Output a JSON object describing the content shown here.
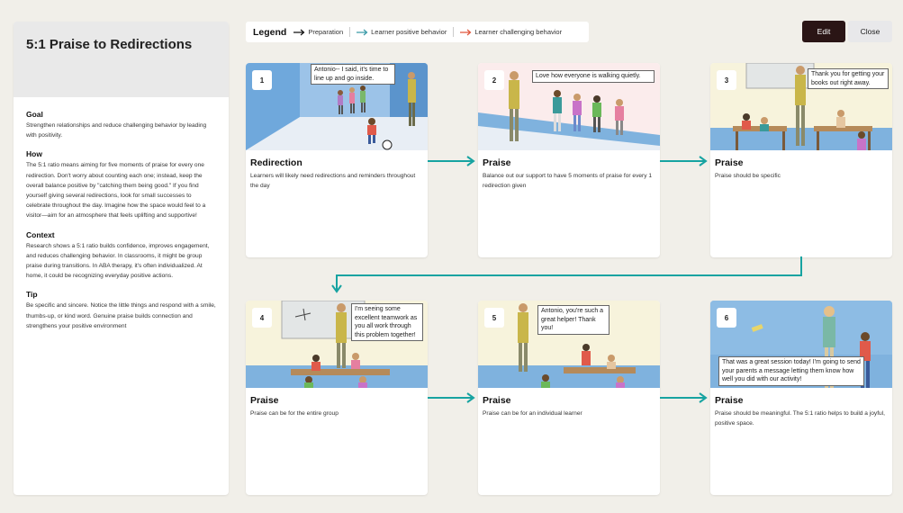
{
  "sidebar": {
    "title": "5:1 Praise to Redirections",
    "sections": [
      {
        "heading": "Goal",
        "text": "Strengthen relationships and reduce challenging behavior by leading with positivity."
      },
      {
        "heading": "How",
        "text": "The 5:1 ratio means aiming for five moments of praise for every one redirection. Don't worry about counting each one; instead, keep the overall balance positive by \"catching them being good.\" If you find yourself giving several redirections, look for small successes to celebrate throughout the day. Imagine how the space would feel to a visitor—aim for an atmosphere that feels uplifting and supportive!"
      },
      {
        "heading": "Context",
        "text": "Research shows a 5:1 ratio builds confidence, improves engagement, and reduces challenging behavior. In classrooms, it might be group praise during transitions. In ABA therapy, it's often individualized. At home, it could be recognizing everyday positive actions."
      },
      {
        "heading": "Tip",
        "text": "Be specific and sincere. Notice the little things and respond with a smile, thumbs-up, or kind word. Genuine praise builds connection and strengthens your positive environment"
      }
    ]
  },
  "legend": {
    "title": "Legend",
    "items": [
      {
        "label": "Preparation",
        "color": "#111111"
      },
      {
        "label": "Learner positive behavior",
        "color": "#3a9aa8"
      },
      {
        "label": "Learner challenging behavior",
        "color": "#e0553a"
      }
    ]
  },
  "buttons": {
    "edit": "Edit",
    "close": "Close"
  },
  "cards": [
    {
      "num": "1",
      "title": "Redirection",
      "desc": "Learners will likely need redirections and reminders throughout the day",
      "bubble": "Antonio-- I said, it's time to line up and go inside."
    },
    {
      "num": "2",
      "title": "Praise",
      "desc": "Balance out our support to have 5 moments of praise for every 1 redirection given",
      "bubble": "Love how everyone is walking quietly."
    },
    {
      "num": "3",
      "title": "Praise",
      "desc": "Praise should be specific",
      "bubble": "Thank you for getting your books out right away."
    },
    {
      "num": "4",
      "title": "Praise",
      "desc": "Praise can be for the entire group",
      "bubble": "I'm seeing some excellent teamwork as you all work through this problem together!"
    },
    {
      "num": "5",
      "title": "Praise",
      "desc": "Praise can be for an individual learner",
      "bubble": "Antonio, you're such a great helper! Thank you!"
    },
    {
      "num": "6",
      "title": "Praise",
      "desc": "Praise should be meaningful. The 5:1 ratio helps to build a joyful, positive space.",
      "bubble": "That was a great session today! I'm going to send your parents a message letting them know how well you did with our activity!"
    }
  ],
  "colors": {
    "flow_arrow": "#17a3a1",
    "edit_bg": "#2a1515"
  }
}
